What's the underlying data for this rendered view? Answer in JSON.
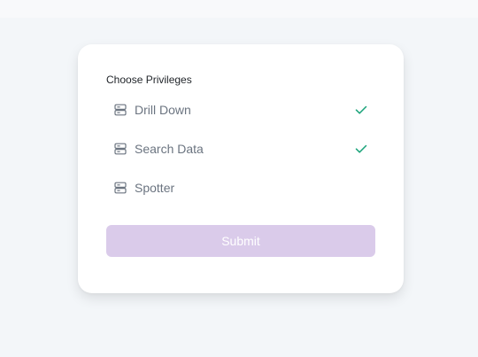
{
  "form": {
    "section_label": "Choose Privileges",
    "options": [
      {
        "label": "Drill Down",
        "icon": "database-icon",
        "selected": true
      },
      {
        "label": "Search Data",
        "icon": "database-icon",
        "selected": true
      },
      {
        "label": "Spotter",
        "icon": "database-icon",
        "selected": false
      }
    ],
    "submit_label": "Submit",
    "submit_disabled": true
  },
  "colors": {
    "page_background": "#f3f6f9",
    "card_background": "#ffffff",
    "check": "#1aa37a",
    "submit_disabled_bg": "#dacbea"
  }
}
